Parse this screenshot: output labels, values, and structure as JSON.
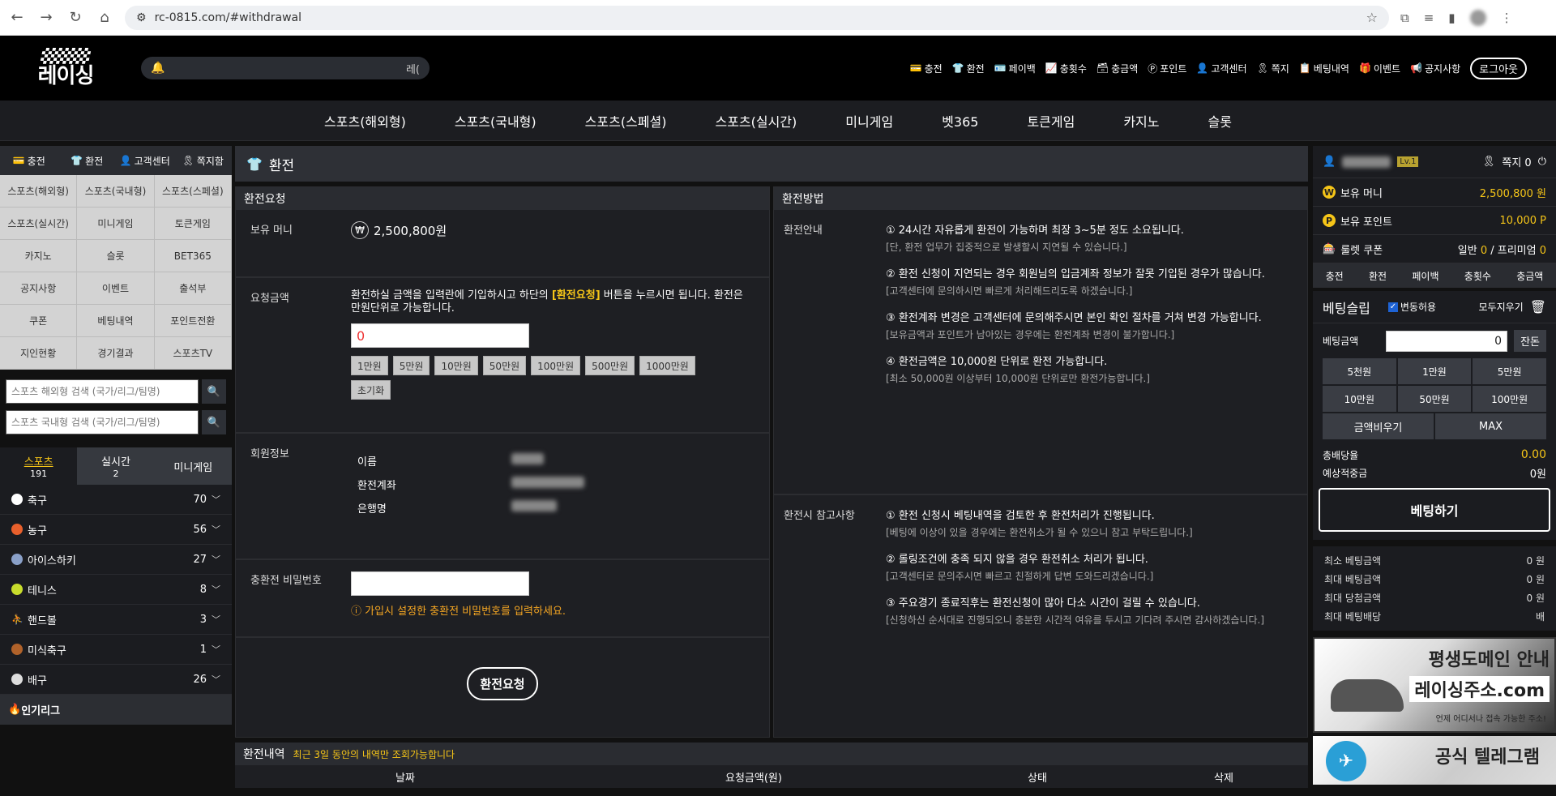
{
  "browser": {
    "url": "rc-0815.com/#withdrawal"
  },
  "header": {
    "logo_text": "레이싱",
    "notice_text": "레(",
    "menu": [
      {
        "icon": "💳",
        "label": "충전"
      },
      {
        "icon": "👕",
        "label": "환전"
      },
      {
        "icon": "🪪",
        "label": "페이백"
      },
      {
        "icon": "📈",
        "label": "충횟수"
      },
      {
        "icon": "🗃",
        "label": "충금액"
      },
      {
        "icon": "Ⓟ",
        "label": "포인트"
      },
      {
        "icon": "👤",
        "label": "고객센터"
      },
      {
        "icon": "🎗",
        "label": "쪽지"
      },
      {
        "icon": "📋",
        "label": "베팅내역"
      },
      {
        "icon": "🎁",
        "label": "이벤트"
      },
      {
        "icon": "📢",
        "label": "공지사항"
      }
    ],
    "logout": "로그아웃"
  },
  "mainnav": [
    "스포츠(해외형)",
    "스포츠(국내형)",
    "스포츠(스페셜)",
    "스포츠(실시간)",
    "미니게임",
    "벳365",
    "토큰게임",
    "카지노",
    "슬롯"
  ],
  "left": {
    "tabs": [
      {
        "icon": "💳",
        "label": "충전"
      },
      {
        "icon": "👕",
        "label": "환전"
      },
      {
        "icon": "👤",
        "label": "고객센터"
      },
      {
        "icon": "🎗",
        "label": "쪽지함"
      }
    ],
    "grid": [
      "스포츠(해외형)",
      "스포츠(국내형)",
      "스포츠(스페셜)",
      "스포츠(실시간)",
      "미니게임",
      "토큰게임",
      "카지노",
      "슬롯",
      "BET365",
      "공지사항",
      "이벤트",
      "출석부",
      "쿠폰",
      "베팅내역",
      "포인트전환",
      "지인현황",
      "경기결과",
      "스포츠TV"
    ],
    "search1": "스포츠 해외형 검색 (국가/리그/팀명)",
    "search2": "스포츠 국내형 검색 (국가/리그/팀명)",
    "cattabs": [
      {
        "label": "스포츠",
        "count": "191"
      },
      {
        "label": "실시간",
        "count": "2"
      },
      {
        "label": "미니게임",
        "count": ""
      }
    ],
    "sports": [
      {
        "label": "축구",
        "count": "70",
        "color": "#ffffff"
      },
      {
        "label": "농구",
        "count": "56",
        "color": "#e8602c"
      },
      {
        "label": "아이스하키",
        "count": "27",
        "color": "#8aa0c8"
      },
      {
        "label": "테니스",
        "count": "8",
        "color": "#c8dc2c"
      },
      {
        "label": "핸드볼",
        "count": "3",
        "color": "#ffffff"
      },
      {
        "label": "미식축구",
        "count": "1",
        "color": "#b0622a"
      },
      {
        "label": "배구",
        "count": "26",
        "color": "#dddddd"
      }
    ],
    "popular": "인기리그"
  },
  "main": {
    "title": "환전",
    "request_head": "환전요청",
    "method_head": "환전방법",
    "balance_label": "보유 머니",
    "balance_value": "2,500,800원",
    "amount_label": "요청금액",
    "amount_desc_1": "환전하실 금액을 입력란에 기입하시고 하단의 ",
    "amount_desc_hl": "[환전요청]",
    "amount_desc_2": " 버튼을 누르시면 됩니다. 환전은 만원단위로 가능합니다.",
    "amount_value": "0",
    "amount_buttons": [
      "1만원",
      "5만원",
      "10만원",
      "50만원",
      "100만원",
      "500만원",
      "1000만원"
    ],
    "reset_button": "초기화",
    "member_label": "회원정보",
    "member_rows": [
      {
        "key": "이름"
      },
      {
        "key": "환전계좌"
      },
      {
        "key": "은행명"
      }
    ],
    "pw_label": "충환전 비밀번호",
    "pw_warn": "ⓘ 가입시 설정한 충환전 비밀번호를 입력하세요.",
    "submit": "환전요청",
    "guide_label": "환전안내",
    "guide_items": [
      {
        "t": "① 24시간 자유롭게 환전이 가능하며 최장 3~5분 정도 소요됩니다.",
        "s": "[단, 환전 업무가 집중적으로 발생할시 지연될 수 있습니다.]"
      },
      {
        "t": "② 환전 신청이 지연되는 경우 회원님의 입금계좌 정보가 잘못 기입된 경우가 많습니다.",
        "s": "[고객센터에 문의하시면 빠르게 처리해드리도록 하겠습니다.]"
      },
      {
        "t": "③ 환전계좌 변경은 고객센터에 문의해주시면 본인 확인 절차를 거쳐 변경 가능합니다.",
        "s": "[보유금액과 포인트가 남아있는 경우에는 환전계좌 변경이 불가합니다.]"
      },
      {
        "t": "④ 환전금액은 10,000원 단위로 환전 가능합니다.",
        "s": "[최소 50,000원 이상부터 10,000원 단위로만 환전가능합니다.]"
      }
    ],
    "ref_label": "환전시 참고사항",
    "ref_items": [
      {
        "t": "① 환전 신청시 베팅내역을 검토한 후 환전처리가 진행됩니다.",
        "s": "[베팅에 이상이 있을 경우에는 환전취소가 될 수 있으니 참고 부탁드립니다.]"
      },
      {
        "t": "② 롤링조건에 충족 되지 않을 경우 환전취소 처리가 됩니다.",
        "s": "[고객센터로 문의주시면 빠르고 친절하게 답변 도와드리겠습니다.]"
      },
      {
        "t": "③ 주요경기 종료직후는 환전신청이 많아 다소 시간이 걸릴 수 있습니다.",
        "s": "[신청하신 순서대로 진행되오니 충분한 시간적 여유를 두시고 기다려 주시면 감사하겠습니다.]"
      }
    ],
    "history_head": "환전내역",
    "history_note": "최근 3일 동안의 내역만 조회가능합니다",
    "history_cols": [
      "날짜",
      "요청금액(원)",
      "상태",
      "삭제"
    ]
  },
  "right": {
    "lv": "Lv.1",
    "msg": "쪽지 0",
    "money_label": "보유 머니",
    "money_value": "2,500,800 원",
    "point_label": "보유 포인트",
    "point_value": "10,000 P",
    "coupon_label": "룰렛 쿠폰",
    "coupon_normal": "일반 ",
    "coupon_normal_v": "0",
    "coupon_sep": " / 프리미엄 ",
    "coupon_premium_v": "0",
    "tabs": [
      "충전",
      "환전",
      "페이백",
      "충횟수",
      "충금액"
    ],
    "slip_title": "베팅슬립",
    "slip_chk": "변동허용",
    "slip_clear": "모두지우기",
    "bet_label": "베팅금액",
    "bet_value": "0",
    "bal_btn": "잔돈",
    "chips": [
      "5천원",
      "1만원",
      "5만원",
      "10만원",
      "50만원",
      "100만원"
    ],
    "clear_btn": "금액비우기",
    "max_btn": "MAX",
    "total_odds_label": "총배당율",
    "total_odds": "0.00",
    "expect_label": "예상적중금",
    "expect_value": "0원",
    "bet_btn": "베팅하기",
    "limits": [
      {
        "k": "최소 베팅금액",
        "v": "0 원"
      },
      {
        "k": "최대 베팅금액",
        "v": "0 원"
      },
      {
        "k": "최대 당첨금액",
        "v": "0 원"
      },
      {
        "k": "최대 베팅배당",
        "v": "배"
      }
    ],
    "banner1_t1": "평생도메인 안내",
    "banner1_t2": "레이싱주소.com",
    "banner1_t3": "언제 어디서나 접속 가능한 주소!",
    "banner2_t1": "공식 텔레그램"
  }
}
